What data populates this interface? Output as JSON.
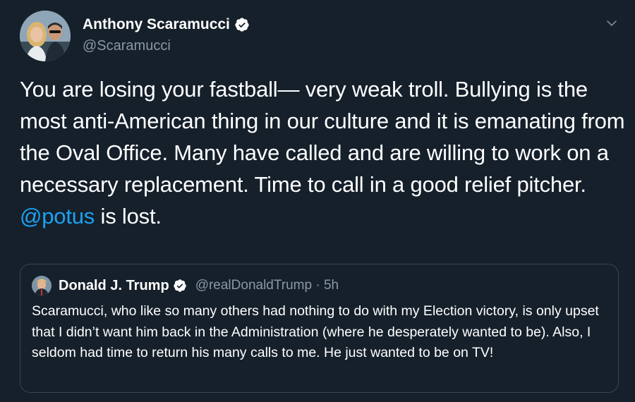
{
  "tweet": {
    "author_name": "Anthony Scaramucci",
    "handle": "@Scaramucci",
    "text_before": "You are losing your fastball— very weak troll. Bullying is the most anti-American thing in our culture and it is emanating from the Oval Office. Many have called  and are willing to work on a necessary replacement. Time to call in a good relief pitcher. ",
    "mention": "@potus",
    "text_after": " is lost."
  },
  "quoted_tweet": {
    "author_name": "Donald J. Trump",
    "handle_time": "@realDonaldTrump · 5h",
    "text": "Scaramucci, who like so many others had nothing to do with my Election victory, is only upset that I didn’t want him back in the Administration (where he desperately wanted to be). Also, I seldom had time to return his many calls to me. He just wanted to be on TV!"
  },
  "icons": {
    "verified": "verified-badge-icon",
    "menu": "chevron-down-icon"
  },
  "colors": {
    "background": "#15202b",
    "link": "#1da1f2",
    "secondary_text": "#8899a6",
    "border": "#38444d"
  }
}
